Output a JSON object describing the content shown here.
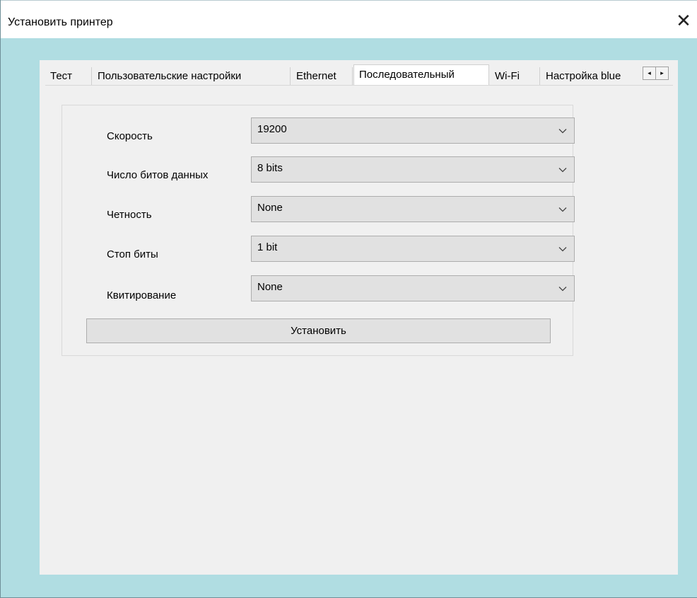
{
  "window": {
    "title": "Установить принтер",
    "close_symbol": "✕"
  },
  "tabs": [
    {
      "label": "Тест"
    },
    {
      "label": "Пользовательские настройки"
    },
    {
      "label": "Ethernet"
    },
    {
      "label": "Последовательный"
    },
    {
      "label": "Wi-Fi"
    },
    {
      "label": "Настройка blue"
    }
  ],
  "active_tab": "Последовательный",
  "tab_scroll": {
    "left_symbol": "◂",
    "right_symbol": "▸"
  },
  "fields": [
    {
      "label": "Скорость",
      "value": "19200"
    },
    {
      "label": "Число битов данных",
      "value": "8 bits"
    },
    {
      "label": "Четность",
      "value": "None"
    },
    {
      "label": "Стоп биты",
      "value": "1 bit"
    },
    {
      "label": "Квитирование",
      "value": "None"
    }
  ],
  "buttons": {
    "install_label": "Установить"
  },
  "icons": {
    "close": "close-icon",
    "dropdown": "chevron-down-icon",
    "scroll_left": "arrow-left-icon",
    "scroll_right": "arrow-right-icon"
  }
}
